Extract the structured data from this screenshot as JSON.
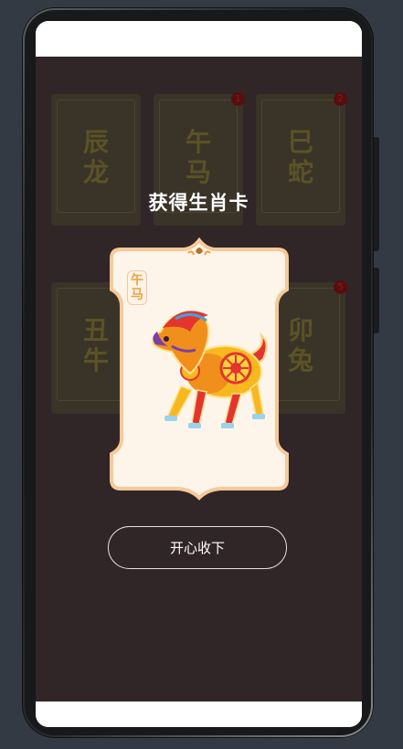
{
  "dialog": {
    "title": "获得生肖卡",
    "accept_button": "开心收下",
    "card": {
      "name_line1": "午",
      "name_line2": "马"
    }
  },
  "background_cards": [
    {
      "line1": "辰",
      "line2": "龙",
      "badge": ""
    },
    {
      "line1": "午",
      "line2": "马",
      "badge": "1"
    },
    {
      "line1": "巳",
      "line2": "蛇",
      "badge": "2"
    },
    {
      "line1": "丑",
      "line2": "牛",
      "badge": ""
    },
    {
      "line1": "",
      "line2": "",
      "badge": ""
    },
    {
      "line1": "卯",
      "line2": "兔",
      "badge": "5"
    }
  ],
  "colors": {
    "overlay": "#302527",
    "card_bg": "#fdf4ea",
    "card_border": "#f6c999",
    "accent_orange": "#f0a23a"
  }
}
